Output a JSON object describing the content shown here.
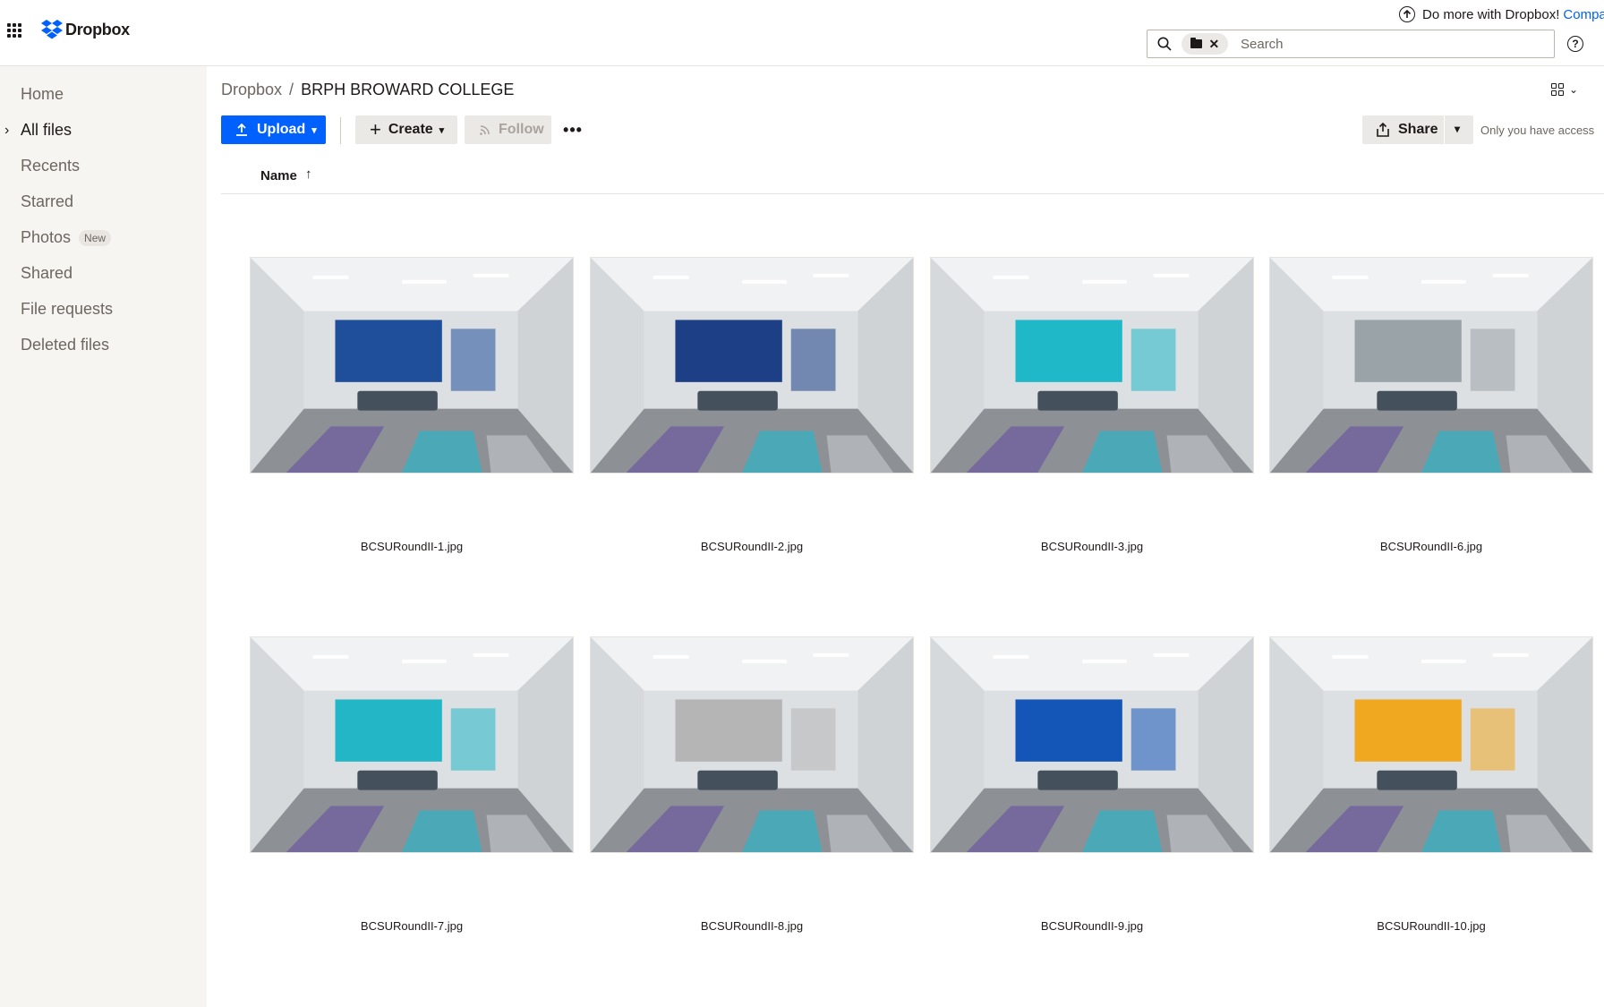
{
  "header": {
    "logo_text": "Dropbox",
    "promo_text": "Do more with Dropbox!",
    "promo_link": "Compa",
    "search_placeholder": "Search"
  },
  "sidebar": {
    "items": [
      {
        "label": "Home"
      },
      {
        "label": "All files",
        "active": true
      },
      {
        "label": "Recents"
      },
      {
        "label": "Starred"
      },
      {
        "label": "Photos",
        "badge": "New"
      },
      {
        "label": "Shared"
      },
      {
        "label": "File requests"
      },
      {
        "label": "Deleted files"
      }
    ]
  },
  "breadcrumb": {
    "root": "Dropbox",
    "separator": "/",
    "current": "BRPH BROWARD COLLEGE"
  },
  "toolbar": {
    "upload_label": "Upload",
    "create_label": "Create",
    "follow_label": "Follow",
    "more_label": "•••",
    "share_label": "Share",
    "access_text": "Only you have access"
  },
  "columns": {
    "name_label": "Name",
    "sort_indicator": "↑"
  },
  "files": [
    {
      "name": "BCSURoundII-1.jpg",
      "accent": "#1f4f9a"
    },
    {
      "name": "BCSURoundII-2.jpg",
      "accent": "#1c3f86"
    },
    {
      "name": "BCSURoundII-3.jpg",
      "accent": "#1fb8c9"
    },
    {
      "name": "BCSURoundII-6.jpg",
      "accent": "#9aa3a8"
    },
    {
      "name": "BCSURoundII-7.jpg",
      "accent": "#22b6c6"
    },
    {
      "name": "BCSURoundII-8.jpg",
      "accent": "#b5b5b5"
    },
    {
      "name": "BCSURoundII-9.jpg",
      "accent": "#1455b8"
    },
    {
      "name": "BCSURoundII-10.jpg",
      "accent": "#f0a820"
    }
  ],
  "colors": {
    "primary": "#0061fe",
    "sidebar_bg": "#f7f5f2",
    "muted_text": "#6d6661"
  }
}
